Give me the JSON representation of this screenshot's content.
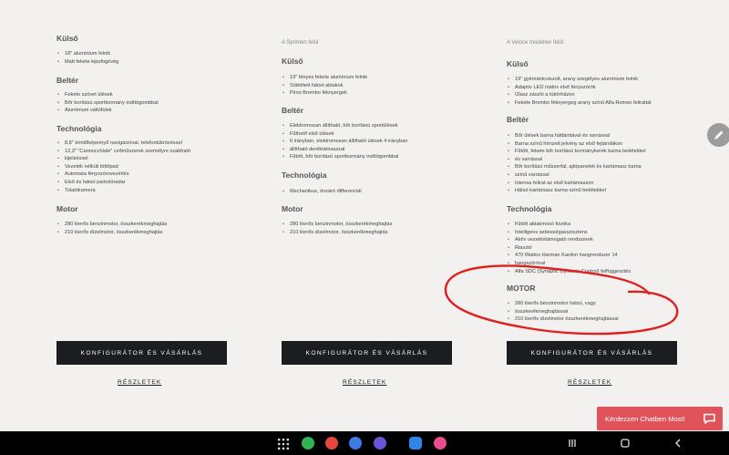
{
  "columns": [
    {
      "pre": "",
      "sections": [
        {
          "title": "Külső",
          "items": [
            "18\" alumínium felnik",
            "Matt fekete kipufogóvég"
          ]
        },
        {
          "title": "Beltér",
          "items": [
            "Fekete szövet ülések",
            "Bőr borítású sportkormány indítógombbal",
            "Alumínium váltófülek"
          ]
        },
        {
          "title": "Technológia",
          "items": [
            "8,8\" érintőképernyő navigációval, telefontükrözéssel",
            "12,3\" \"Cannocchiale\" csőműszerek személyre szabható",
            "kijelzéssel",
            "Vezeték nélküli töltőpad",
            "Automata fényszórovezérlés",
            "Első és hátsó parkolóradar",
            "Tolatókamera"
          ]
        },
        {
          "title": "Motor",
          "items": [
            "280 lóerős benzinmotor, összkerékmeghajtás",
            "210 lóerős dízelmotor, összkerékmeghajtás"
          ]
        }
      ],
      "config_label": "KONFIGURÁTOR ÉS VÁSÁRLÁS",
      "details_label": "RÉSZLETEK"
    },
    {
      "pre": "A Sprinten felül",
      "sections": [
        {
          "title": "Külső",
          "items": [
            "19\" fényes fekete alumínium felnik",
            "Sötétített hátsó ablakok",
            "Piros Brembo féknyergek"
          ]
        },
        {
          "title": "Beltér",
          "items": [
            "Elektromosan állítható, bőr borítású sportülések",
            "Fűthető első ülések",
            "6 irányban, elektromosan állítható ülések 4 irányban",
            "állítható deréktámasszal",
            "Fűtött, bőr borítású sportkormány indítógombbal"
          ]
        },
        {
          "title": "Technológia",
          "items": [
            "Mechanikus, önzáró differenciál"
          ]
        },
        {
          "title": "Motor",
          "items": [
            "280 lóerős benzinmotor, összkerékmeghajtás",
            "210 lóerős dízelmotor, összkerékmeghajtás"
          ]
        }
      ],
      "config_label": "KONFIGURÁTOR ÉS VÁSÁRLÁS",
      "details_label": "RÉSZLETEK"
    },
    {
      "pre": "A Veloce modellen felül",
      "sections": [
        {
          "title": "Külső",
          "items": [
            "19\" gyémántcsiszolt, arany szegélyes alumínium felnik",
            "Adaptív LED mátrix első fényszórók",
            "Olasz zászló a tükörházon",
            "Fekete Brembo féknyergeg arany színű Alfa Romeo felirattal"
          ]
        },
        {
          "title": "Beltér",
          "items": [
            "Bőr ülések barna háttámlával és varrással",
            "Barna színű hímzett jelvény az első fejtámlákon",
            "Fűtött, fekete bőr borítású kormánykerék barna betétekkel",
            "és varrással",
            "Bőr borítású műszerfal, ajtópanelek és kartámasz barna",
            "színű varrással",
            "Intensa felirat az első kartámaszon",
            "Hátsó kartámasz barna színű betétekkel"
          ]
        },
        {
          "title": "Technológia",
          "items": [
            "Fűtött ablakmosó fúvóka",
            "Intelligens sebességasszisztens",
            "Aktív vezetéstámogató rendszerek",
            "Riasztó",
            "470 Wattos Harman Kardon hangrendszer 14",
            "hangszóróval",
            "Alfa SDC (Synaptic Dynamic Control) felfüggesztés"
          ]
        },
        {
          "title": "MOTOR",
          "items": [
            "280 lóerős benzinmotor hátsó, vagy",
            "összkerékmeghajtással",
            "210 lóerős dízelmotor összkerékmeghajtással"
          ]
        }
      ],
      "config_label": "KONFIGURÁTOR ÉS VÁSÁRLÁS",
      "details_label": "RÉSZLETEK"
    }
  ],
  "chat": {
    "label": "Kérdezzen Chatben Most!"
  },
  "colors": {
    "button": "#1b1d20",
    "chat": "#e0535b",
    "annotation": "#e02020",
    "background": "#f2f1ef"
  },
  "icons": [
    "pencil-icon",
    "chat-bubble-icon",
    "apps-grid-icon",
    "phone-app-icon",
    "contacts-app-icon",
    "messages-app-icon",
    "browser-app-icon",
    "mail-app-icon",
    "gallery-app-icon",
    "recents-icon",
    "home-icon",
    "back-icon"
  ]
}
